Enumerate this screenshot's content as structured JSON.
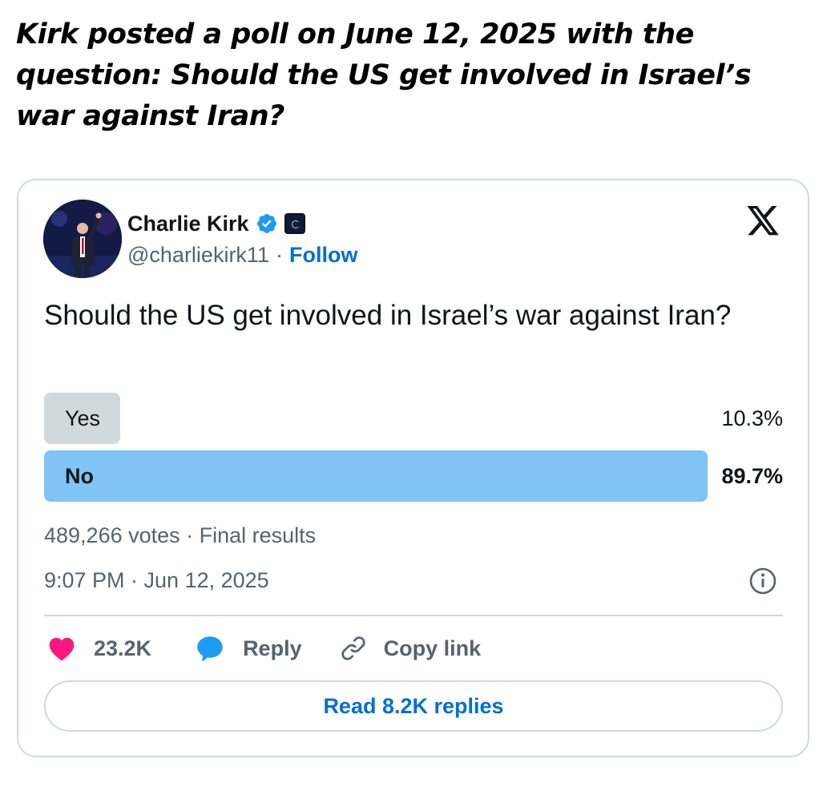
{
  "headline": "Kirk posted a poll on June 12, 2025 with the question: Should the US get involved in Israel’s war against Iran?",
  "tweet": {
    "author": {
      "name": "Charlie Kirk",
      "handle": "@charliekirk11",
      "separator": "·",
      "follow_label": "Follow"
    },
    "platform_icon": "x-logo-icon",
    "text": "Should the US get involved in Israel’s war against Iran?",
    "poll": {
      "options": [
        {
          "label": "Yes",
          "percent": "10.3%",
          "fraction": 0.103,
          "winner": false
        },
        {
          "label": "No",
          "percent": "89.7%",
          "fraction": 0.897,
          "winner": true
        }
      ],
      "meta": "489,266 votes · Final results"
    },
    "timestamp": "9:07 PM · Jun 12, 2025",
    "actions": {
      "like_count": "23.2K",
      "reply_label": "Reply",
      "copy_label": "Copy link"
    },
    "read_replies_label": "Read 8.2K replies"
  },
  "colors": {
    "accent": "#006fd6",
    "poll_winner": "#7fc4f4",
    "poll_loser": "#cfd9de",
    "like": "#f91880",
    "reply": "#1d9bf0",
    "verified": "#1d9bf0"
  },
  "icons": [
    "verified-badge-icon",
    "affiliate-badge-icon",
    "x-logo-icon",
    "info-icon",
    "heart-icon",
    "reply-bubble-icon",
    "link-icon"
  ]
}
